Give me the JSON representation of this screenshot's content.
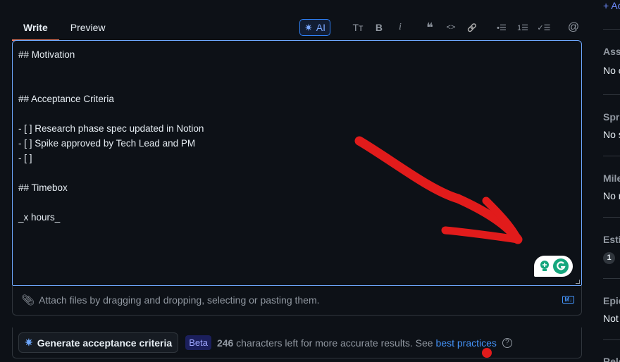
{
  "tabs": [
    {
      "label": "Write",
      "active": true
    },
    {
      "label": "Preview",
      "active": false
    }
  ],
  "toolbar": {
    "ai_label": "AI",
    "icons": [
      "heading-icon",
      "bold-icon",
      "italic-icon",
      "quote-icon",
      "code-icon",
      "link-icon",
      "unordered-list-icon",
      "ordered-list-icon",
      "task-list-icon",
      "mention-icon"
    ],
    "heading": "Tт",
    "bold": "B",
    "italic": "i",
    "quote": "❝",
    "code": "<>",
    "link": "🔗",
    "ul": "•☰",
    "ol": "1☰",
    "task": "✓☰",
    "mention": "@"
  },
  "editor": {
    "lines": [
      "## Motivation",
      "",
      "",
      "## Acceptance Criteria",
      "",
      "- [ ] Research phase spec updated in Notion",
      "- [ ] Spike approved by Tech Lead and PM",
      "- [ ]",
      "",
      "## Timebox",
      "",
      "_x hours_"
    ]
  },
  "attach": {
    "text": "Attach files by dragging and dropping, selecting or pasting them.",
    "markdown_badge": "M↓"
  },
  "generate": {
    "button": "Generate acceptance criteria",
    "beta": "Beta",
    "count": "246",
    "text": " characters left for more accurate results. See",
    "link": "best practices",
    "help": "?"
  },
  "sidebar": {
    "add": "+ Ac",
    "assignees": "Ass",
    "assignees_value": "No c",
    "sprint": "Spr",
    "sprint_value": "No s",
    "milestone": "Mile",
    "milestone_value": "No r",
    "estimate": "Esti",
    "estimate_value": "1",
    "epic": "Epic",
    "epic_value": "Not",
    "release": "Rele"
  },
  "colors": {
    "accent": "#4493f8",
    "focus_border": "#6ea8fe",
    "annotation": "#e11b1b",
    "background": "#0d1117"
  }
}
